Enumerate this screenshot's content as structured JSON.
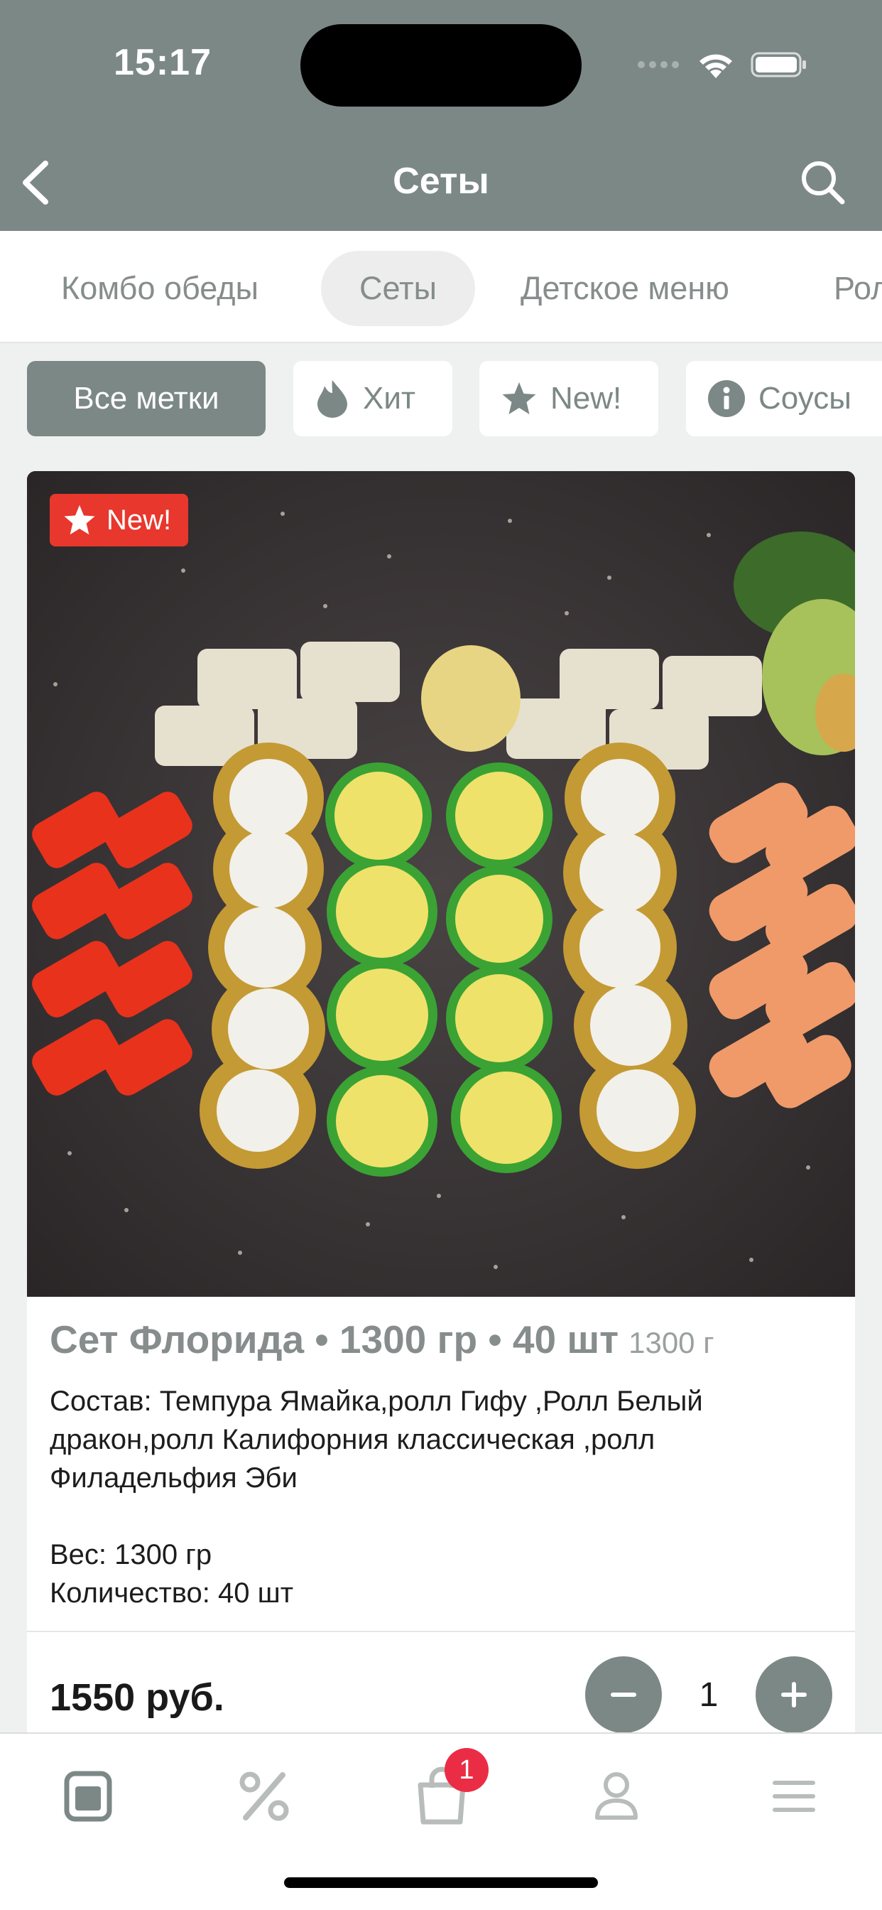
{
  "status": {
    "time": "15:17"
  },
  "nav": {
    "title": "Сеты",
    "back_icon": "chevron-left-icon",
    "search_icon": "search-icon"
  },
  "tabs": [
    "Комбо обеды",
    "Сеты",
    "Детское меню",
    "Рол"
  ],
  "active_tab": "Сеты",
  "chips": [
    {
      "label": "Все метки",
      "icon": "",
      "active": true
    },
    {
      "label": "Хит",
      "icon": "flame-icon",
      "active": false
    },
    {
      "label": "New!",
      "icon": "star-icon",
      "active": false
    },
    {
      "label": "Соусы",
      "icon": "info-icon",
      "active": false
    }
  ],
  "product": {
    "badge": "New!",
    "title": "Сет Флорида • 1300 гр • 40 шт",
    "weight": "1300 г",
    "description": "Состав: Темпура Ямайка,ролл Гифу ,Ролл Белый дракон,ролл Калифорния классическая ,ролл Филадельфия Эби\n\nВес: 1300 гр\nКоличество: 40 шт",
    "price": "1550 руб.",
    "quantity": "1"
  },
  "tabbar": {
    "cart_count": "1"
  },
  "colors": {
    "header": "#7c8886",
    "accent": "#7c8886",
    "badge_red": "#e8372c",
    "cart_badge": "#ea2d45"
  }
}
